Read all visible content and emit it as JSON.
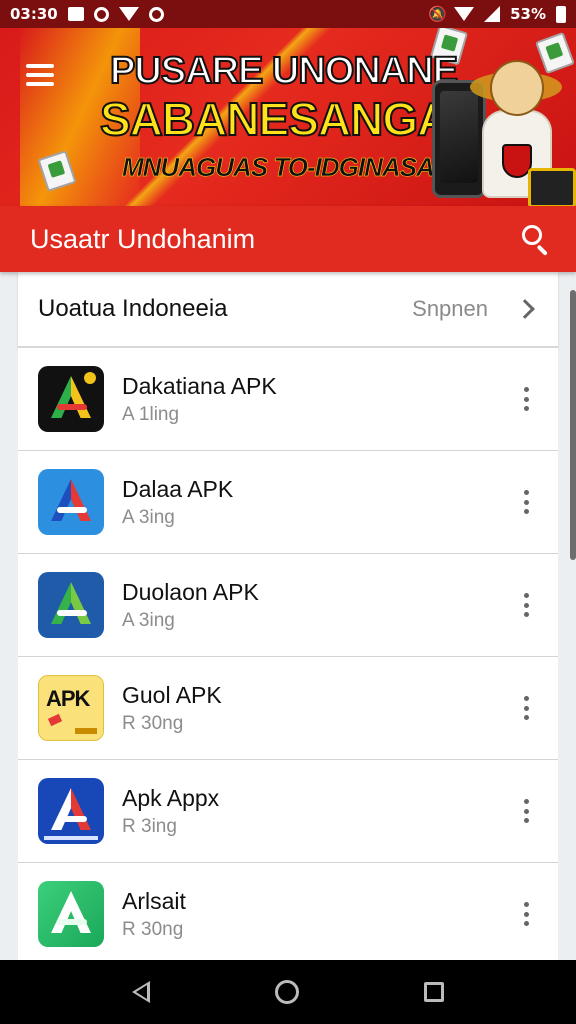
{
  "status_bar": {
    "time": "03:30",
    "battery": "53%",
    "icons": [
      "image-icon",
      "circle-icon",
      "wifi-icon",
      "sync-icon",
      "mute-icon",
      "wifi-icon",
      "signal-icon",
      "battery-icon"
    ]
  },
  "banner": {
    "line1": "PUSARE UNONANE",
    "line2": "SABANESANGA",
    "line3": "MNUAGUAS TO-IDGINASA",
    "colors": {
      "background": "#e22b20",
      "headline": "#ffe21a"
    }
  },
  "toolbar": {
    "title": "Usaatr Undohanim",
    "color": "#e22b20"
  },
  "section": {
    "title": "Uoatua Indoneeia",
    "link": "Snpnen"
  },
  "apps": [
    {
      "name": "Dakatiana APK",
      "sub": "A 1ling",
      "icon": "green-yellow-triangle-icon"
    },
    {
      "name": "Dalaa APK",
      "sub": "A 3ing",
      "icon": "blue-red-triangle-icon"
    },
    {
      "name": "Duolaon APK",
      "sub": "A 3ing",
      "icon": "blue-green-triangle-icon"
    },
    {
      "name": "Guol APK",
      "sub": "R 30ng",
      "icon": "apk-yellow-icon"
    },
    {
      "name": "Apk Appx",
      "sub": "R 3ing",
      "icon": "blue-red-white-triangle-icon"
    },
    {
      "name": "Arlsait",
      "sub": "R 30ng",
      "icon": "green-triangle-icon"
    }
  ],
  "nav": {
    "icons": [
      "back-icon",
      "home-icon",
      "recents-icon"
    ]
  }
}
